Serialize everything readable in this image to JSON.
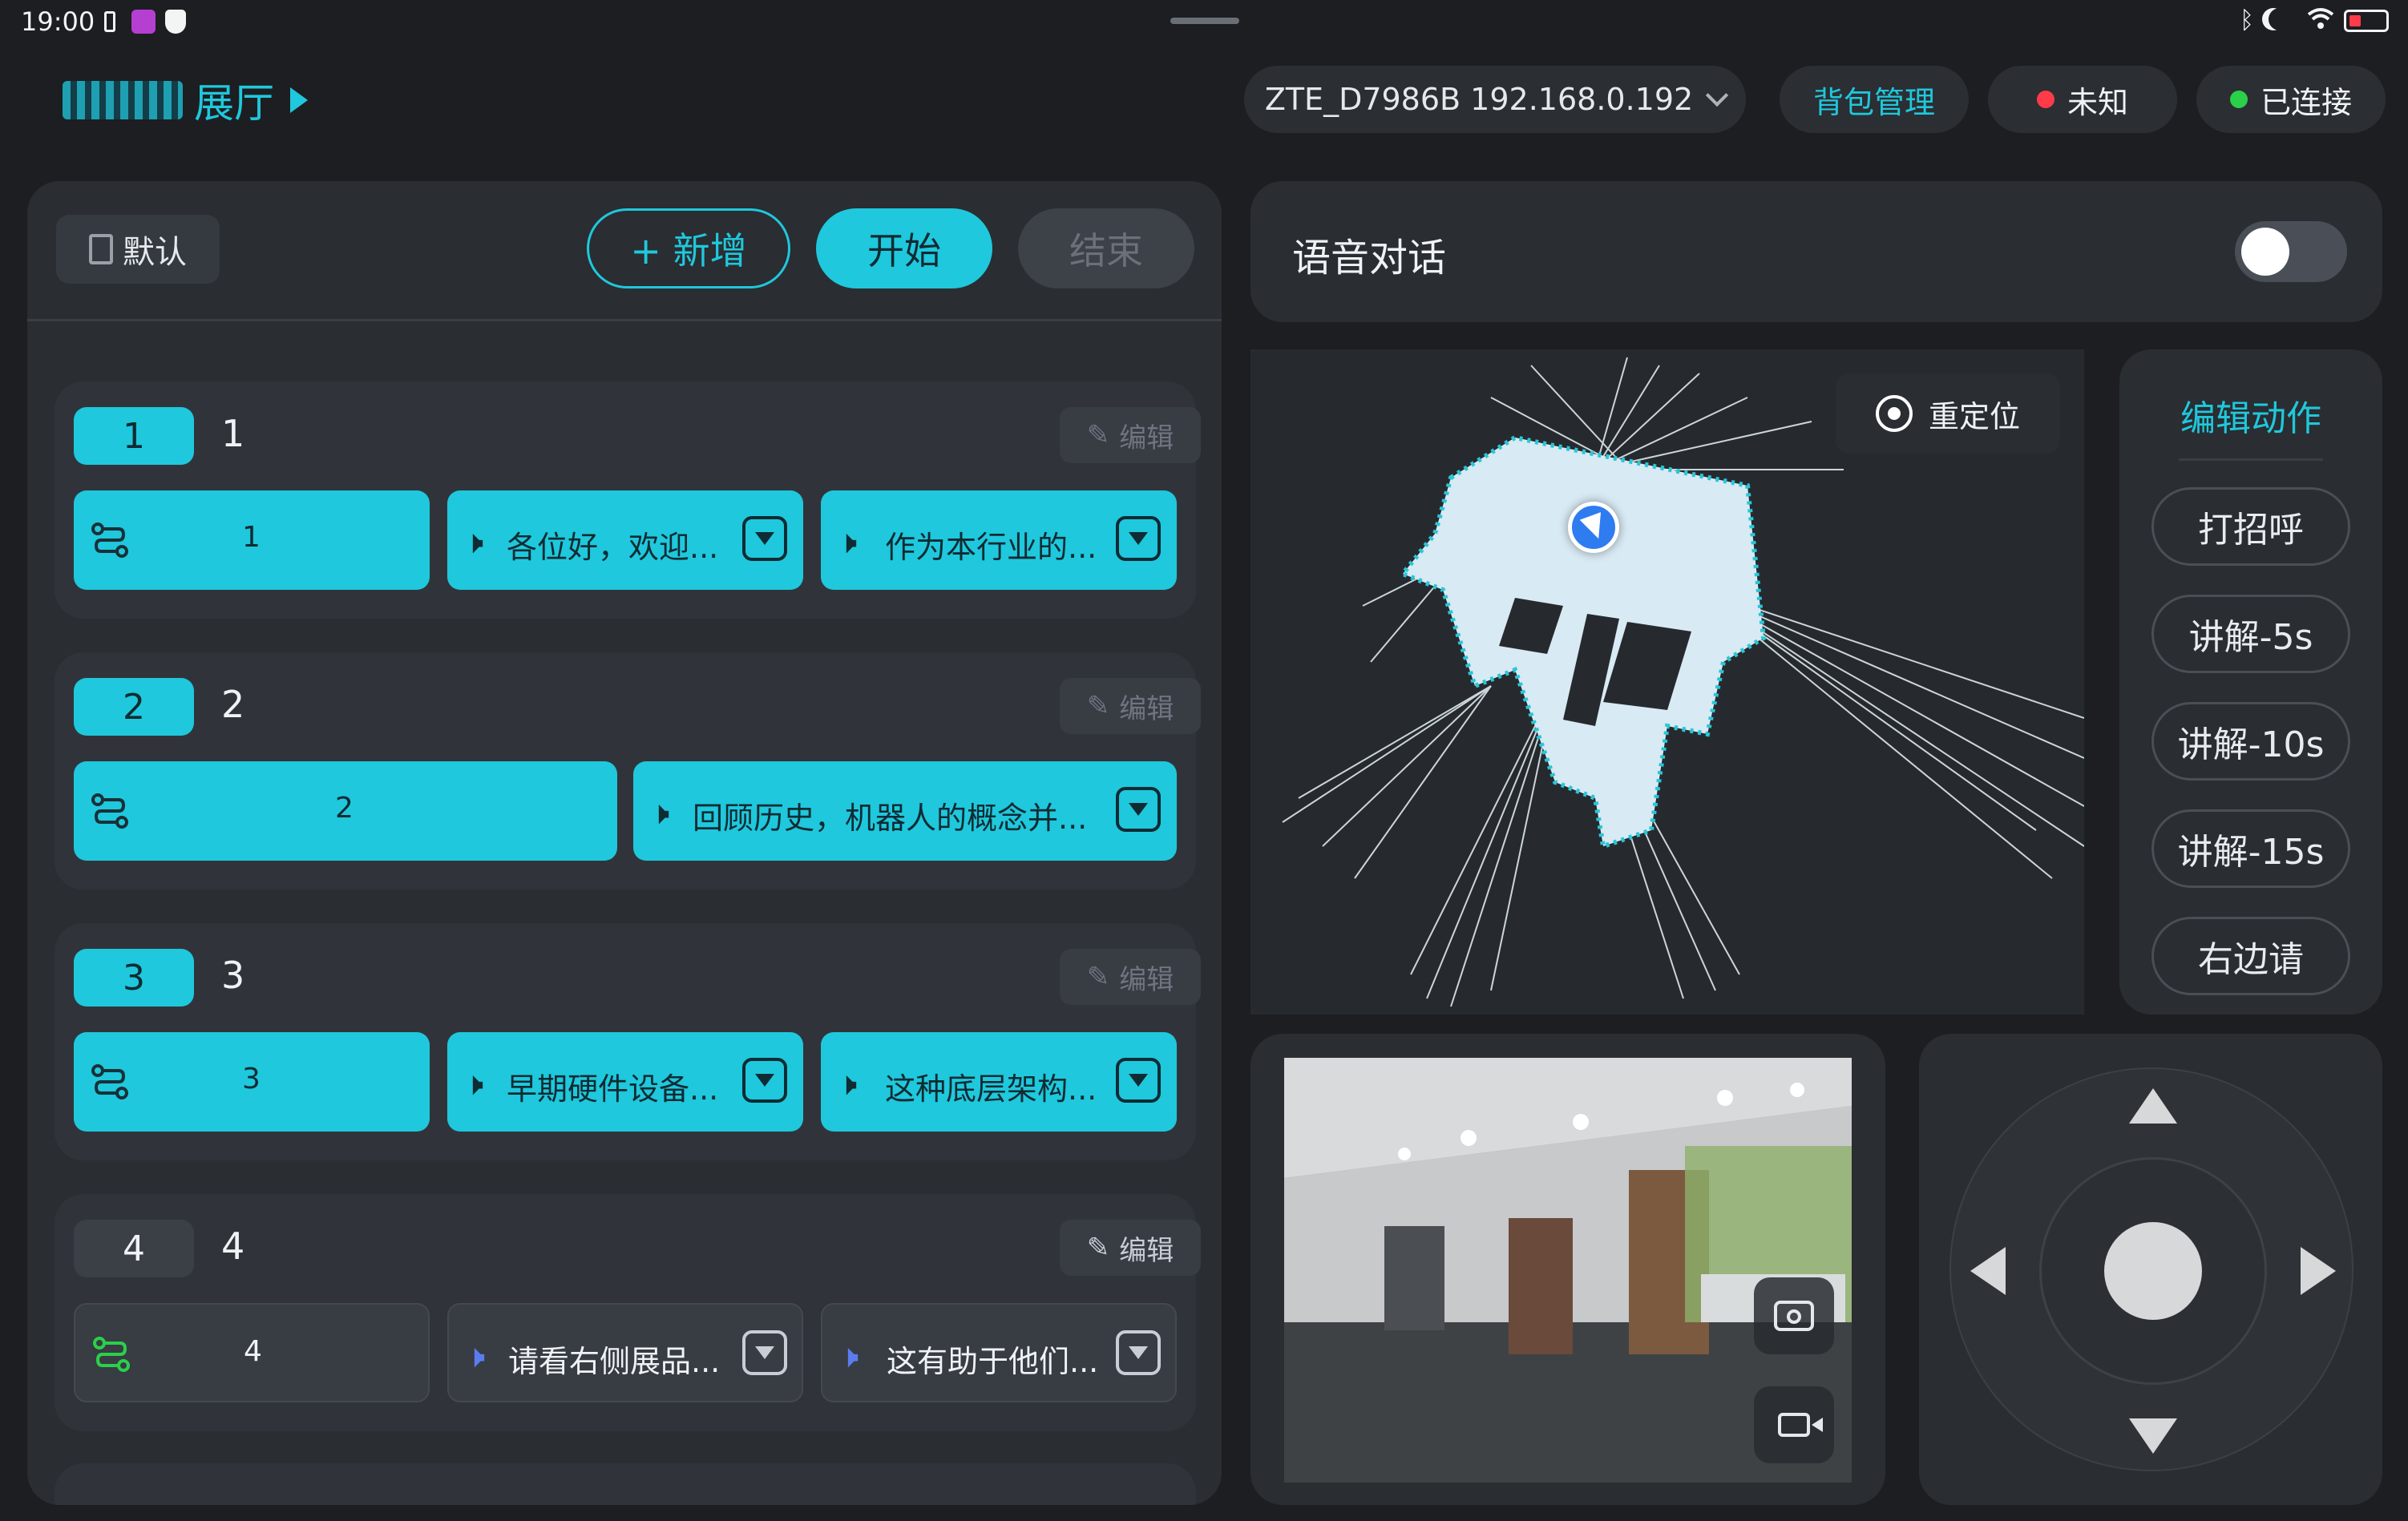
{
  "status_bar": {
    "time": "19:00"
  },
  "header": {
    "app_title": "展厅",
    "wifi_selector": "ZTE_D7986B 192.168.0.192",
    "backpack_button": "背包管理",
    "status_unknown": "未知",
    "status_connected": "已连接"
  },
  "toolbar": {
    "default_label": "默认",
    "add_label": "+ 新增",
    "start_label": "开始",
    "end_label": "结束"
  },
  "routes": [
    {
      "num": "1",
      "title": "1",
      "edit": "编辑",
      "nav_label": "1",
      "speech": [
        "各位好，欢迎...",
        "作为本行业的..."
      ]
    },
    {
      "num": "2",
      "title": "2",
      "edit": "编辑",
      "nav_label": "2",
      "speech": [
        "回顾历史，机器人的概念并..."
      ]
    },
    {
      "num": "3",
      "title": "3",
      "edit": "编辑",
      "nav_label": "3",
      "speech": [
        "早期硬件设备...",
        "这种底层架构..."
      ]
    },
    {
      "num": "4",
      "title": "4",
      "edit": "编辑",
      "nav_label": "4",
      "speech": [
        "请看右侧展品...",
        "这有助于他们..."
      ]
    }
  ],
  "voice": {
    "label": "语音对话",
    "enabled": false
  },
  "map": {
    "relocate_label": "重定位"
  },
  "actions": {
    "title": "编辑动作",
    "items": [
      "打招呼",
      "讲解-5s",
      "讲解-10s",
      "讲解-15s",
      "右边请"
    ]
  },
  "colors": {
    "accent": "#1fc8dc",
    "status_red": "#ff3b4a",
    "status_green": "#2ad04a"
  }
}
